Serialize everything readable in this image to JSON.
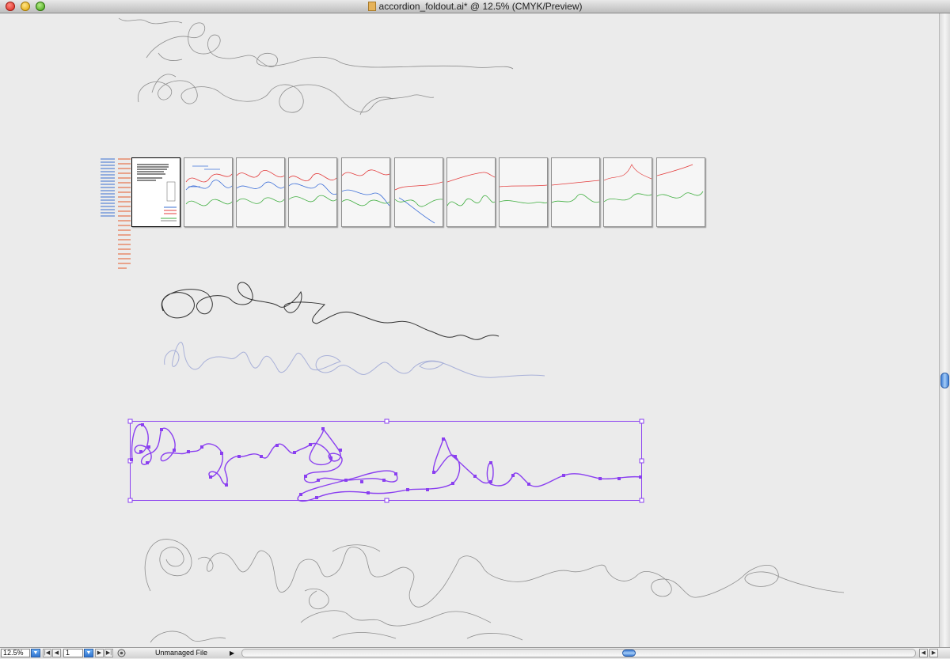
{
  "window": {
    "title": "accordion_foldout.ai* @ 12.5% (CMYK/Preview)",
    "icon": "illustrator-document-icon"
  },
  "status_bar": {
    "zoom_value": "12.5%",
    "page_value": "1",
    "status_text": "Unmanaged File",
    "first_label": "|◀",
    "prev_label": "◀",
    "next_label": "▶",
    "last_label": "▶|",
    "status_arrow": "▶",
    "dropdown_arrow": "▼"
  },
  "colors": {
    "canvas": "#ebebeb",
    "selection": "#8a3ff0",
    "red_path": "#e33b3b",
    "green_path": "#3fae3f",
    "blue_path": "#3d6fd8"
  },
  "artboards_count": 11
}
